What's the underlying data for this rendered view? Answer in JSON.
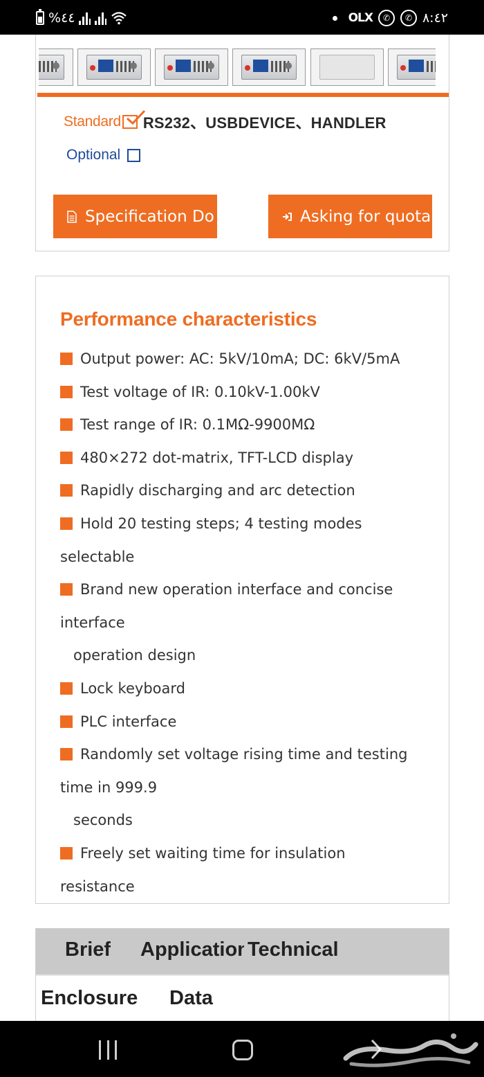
{
  "status_bar": {
    "battery_text": "%٤٤",
    "time": "٨:٤٢",
    "app_icon_olx": "OLX"
  },
  "product": {
    "thumbnails": [
      {
        "name": "thumbnail-1"
      },
      {
        "name": "thumbnail-2"
      },
      {
        "name": "thumbnail-3"
      },
      {
        "name": "thumbnail-4"
      },
      {
        "name": "thumbnail-5"
      },
      {
        "name": "thumbnail-6"
      }
    ],
    "standard_label": "Standard",
    "standard_value": "RS232、USBDEVICE、HANDLER",
    "optional_label": "Optional",
    "spec_button": "Specification Do",
    "quote_button": "Asking for quota"
  },
  "performance": {
    "title": "Performance characteristics",
    "lines": [
      {
        "bullet": true,
        "text": "Output power: AC: 5kV/10mA; DC: 6kV/5mA"
      },
      {
        "bullet": true,
        "text": "Test voltage of IR: 0.10kV-1.00kV"
      },
      {
        "bullet": true,
        "text": "Test range of IR: 0.1MΩ-9900MΩ"
      },
      {
        "bullet": true,
        "text": "480×272 dot-matrix, TFT-LCD display"
      },
      {
        "bullet": true,
        "text": "Rapidly discharging and arc detection"
      },
      {
        "bullet": true,
        "text": "Hold 20 testing steps; 4 testing modes"
      },
      {
        "bullet": false,
        "text": "selectable"
      },
      {
        "bullet": true,
        "text": "Brand new operation interface and concise"
      },
      {
        "bullet": false,
        "text": "interface"
      },
      {
        "bullet": false,
        "indent": true,
        "text": "operation design"
      },
      {
        "bullet": true,
        "text": "Lock keyboard"
      },
      {
        "bullet": true,
        "text": "PLC interface"
      },
      {
        "bullet": true,
        "text": "Randomly set voltage rising time and testing"
      },
      {
        "bullet": false,
        "text": "time in 999.9"
      },
      {
        "bullet": false,
        "indent": true,
        "text": "seconds"
      },
      {
        "bullet": true,
        "text": "Freely set waiting time for insulation"
      },
      {
        "bullet": false,
        "text": "resistance"
      }
    ]
  },
  "tabs": {
    "brief": "Brief",
    "application": "Application",
    "technical": "Technical",
    "enclosure": "Enclosure",
    "data": "Data"
  },
  "colors": {
    "accent_orange": "#ee6d22",
    "optional_blue": "#1e4a9a",
    "tab_header_bg": "#c9c9c9"
  }
}
